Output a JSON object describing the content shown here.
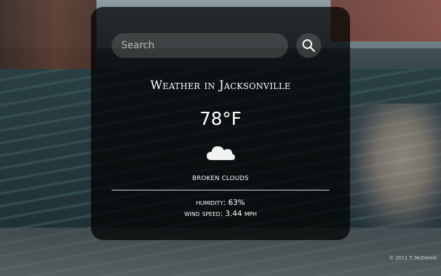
{
  "background": {
    "credit": "© 2011 T. McDaniel"
  },
  "search": {
    "placeholder": "Search",
    "value": "",
    "button_icon": "search-icon"
  },
  "weather": {
    "title": "Weather in Jacksonville",
    "temperature": "78°F",
    "icon": "cloud-icon",
    "description": "broken clouds",
    "humidity_label": "humidity:",
    "humidity_value": "63%",
    "wind_label": "wind speed:",
    "wind_value": "3.44 mph"
  },
  "colors": {
    "card_background": "#000000",
    "text": "#ffffff",
    "divider": "#d8d8d8"
  }
}
